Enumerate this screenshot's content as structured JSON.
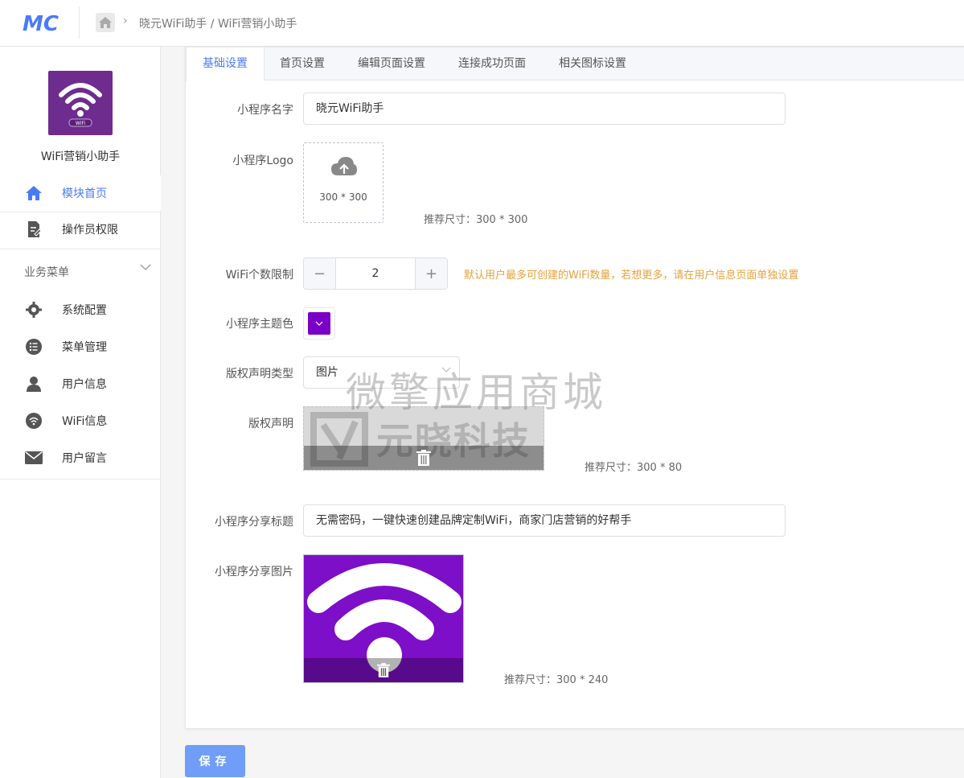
{
  "header": {
    "logo_text": "MC",
    "breadcrumb": "晓元WiFi助手 / WiFi营销小助手"
  },
  "sidebar": {
    "app_name": "WiFi营销小助手",
    "app_logo_text": "WiFi",
    "items_top": [
      {
        "label": "模块首页",
        "icon": "home-icon",
        "active": true
      },
      {
        "label": "操作员权限",
        "icon": "edit-doc-icon",
        "active": false
      }
    ],
    "section_title": "业务菜单",
    "items": [
      {
        "label": "系统配置",
        "icon": "gear-icon"
      },
      {
        "label": "菜单管理",
        "icon": "list-icon"
      },
      {
        "label": "用户信息",
        "icon": "user-icon"
      },
      {
        "label": "WiFi信息",
        "icon": "wifi-circle-icon"
      },
      {
        "label": "用户留言",
        "icon": "mail-icon"
      }
    ]
  },
  "tabs": [
    {
      "label": "基础设置",
      "active": true
    },
    {
      "label": "首页设置",
      "active": false
    },
    {
      "label": "编辑页面设置",
      "active": false
    },
    {
      "label": "连接成功页面",
      "active": false
    },
    {
      "label": "相关图标设置",
      "active": false
    }
  ],
  "form": {
    "name_label": "小程序名字",
    "name_value": "晓元WiFi助手",
    "logo_label": "小程序Logo",
    "logo_upload_text": "300 * 300",
    "logo_hint": "推荐尺寸：300 * 300",
    "wifi_limit_label": "WiFi个数限制",
    "wifi_limit_value": "2",
    "wifi_limit_minus": "−",
    "wifi_limit_plus": "+",
    "wifi_limit_note": "默认用户最多可创建的WiFi数量，若想更多，请在用户信息页面单独设置",
    "theme_label": "小程序主题色",
    "theme_color": "#7a00c8",
    "copyright_type_label": "版权声明类型",
    "copyright_type_value": "图片",
    "copyright_label": "版权声明",
    "copyright_image_text": "元晓科技",
    "copyright_hint": "推荐尺寸：300 * 80",
    "share_title_label": "小程序分享标题",
    "share_title_value": "无需密码，一键快速创建品牌定制WiFi，商家门店营销的好帮手",
    "share_image_label": "小程序分享图片",
    "share_image_hint": "推荐尺寸：300 * 240",
    "save_label": "保存"
  },
  "watermark": "微擎应用商城",
  "colors": {
    "accent": "#4a7bf7",
    "warning": "#e6a23c",
    "share_bg": "#7d0fc8",
    "app_logo_bg": "#6e2c8f"
  }
}
